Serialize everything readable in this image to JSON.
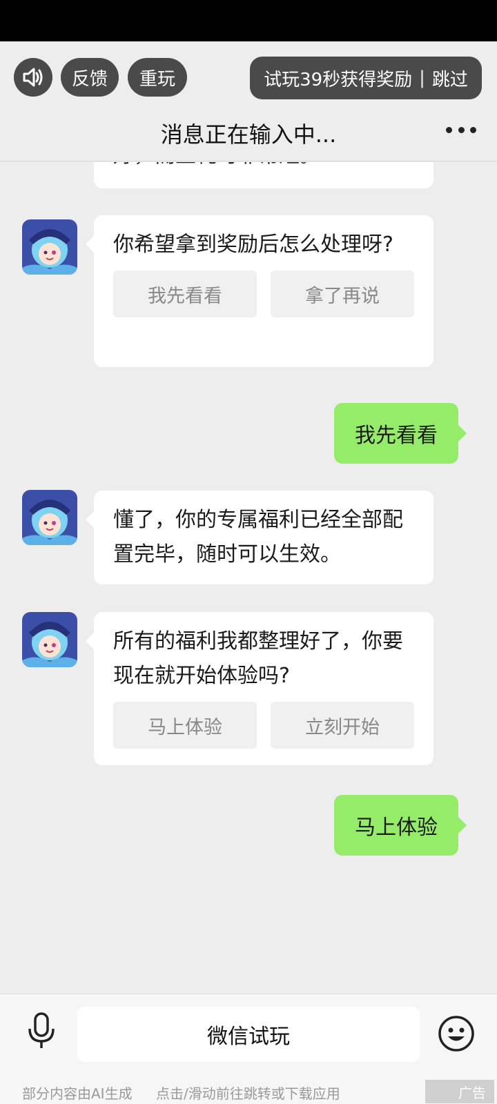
{
  "header": {
    "feedback_label": "反馈",
    "replay_label": "重玩",
    "trial_text": "试玩39秒获得奖励",
    "trial_separator": "|",
    "skip_label": "跳过",
    "chat_title": "消息正在输入中..."
  },
  "messages": {
    "partial_text": "好，而且耗时非常短。",
    "m1_text": "你希望拿到奖励后怎么处理呀?",
    "m1_options": [
      "我先看看",
      "拿了再说"
    ],
    "r1_text": "我先看看",
    "m2_text": "懂了，你的专属福利已经全部配置完毕，随时可以生效。",
    "m3_text": "所有的福利我都整理好了，你要现在就开始体验吗?",
    "m3_options": [
      "马上体验",
      "立刻开始"
    ],
    "r2_text": "马上体验"
  },
  "bottom": {
    "input_label": "微信试玩",
    "ai_note": "部分内容由AI生成",
    "action_note": "点击/滑动前往跳转或下载应用",
    "ad_label": "广告"
  },
  "colors": {
    "user_bubble": "#95ec69",
    "bot_bubble": "#ffffff",
    "background": "#ededed",
    "header_pill": "#4a4a4a"
  },
  "icons": [
    "speaker-icon",
    "more-icon",
    "mic-icon",
    "emoji-icon",
    "avatar"
  ]
}
